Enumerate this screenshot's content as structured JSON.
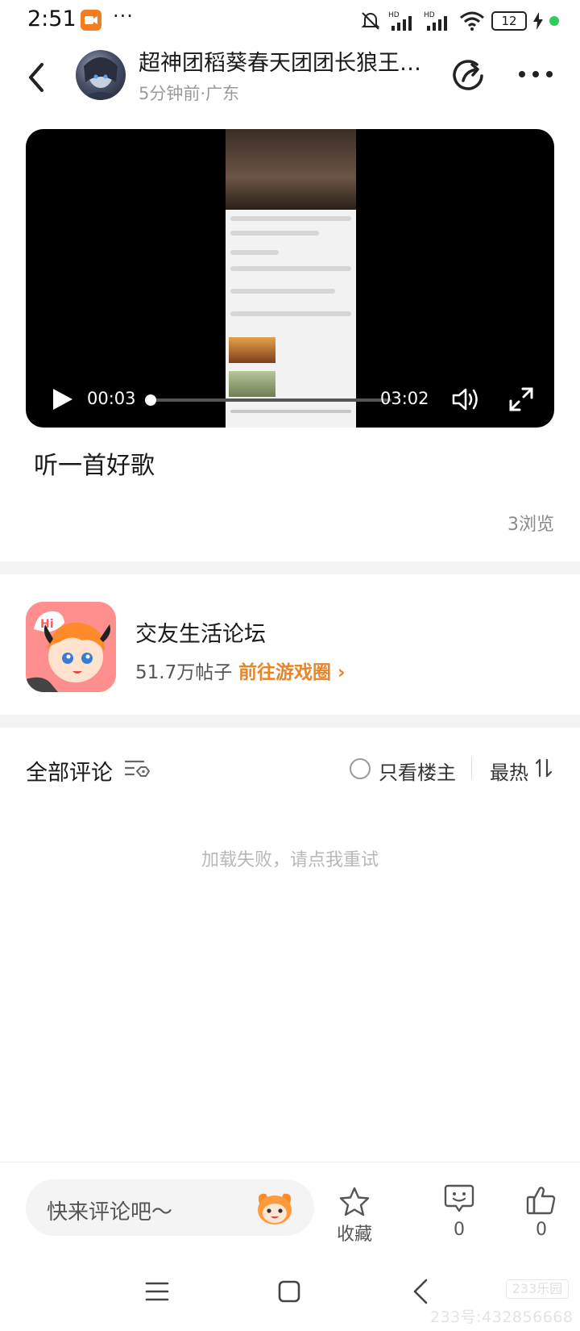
{
  "status_bar": {
    "time": "2:51",
    "more": "···",
    "battery": "12"
  },
  "header": {
    "author": "超神团稻葵春天团团长狼王…",
    "meta": "5分钟前·广东"
  },
  "video": {
    "current_time": "00:03",
    "total_time": "03:02",
    "progress": 0.017
  },
  "post": {
    "title": "听一首好歌",
    "views": "3浏览"
  },
  "forum": {
    "name": "交友生活论坛",
    "posts": "51.7万帖子",
    "link": "前往游戏圈 ›"
  },
  "comments": {
    "title": "全部评论",
    "only_op": "只看楼主",
    "sort": "最热",
    "error": "加载失败，请点我重试"
  },
  "bottom_bar": {
    "placeholder": "快来评论吧～",
    "favorite": "收藏",
    "comment_count": "0",
    "like_count": "0"
  },
  "watermark": {
    "logo": "233乐园",
    "id": "233号:432856668"
  },
  "colors": {
    "accent": "#e6862b",
    "video_bg": "#000000",
    "divider": "#f3f3f3"
  }
}
